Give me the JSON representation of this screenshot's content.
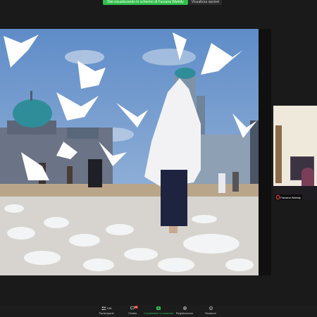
{
  "banner": {
    "sharing_text": "Stai visualizzando lo schermo di Farzana Wahidy",
    "options_label": "Visualizza opzioni"
  },
  "participant": {
    "name": "Farzana Wahidy",
    "mic_muted": true
  },
  "toolbar": {
    "participants_label": "Partecipanti",
    "participants_count": "108",
    "chat_label": "Chatta",
    "chat_badge": "26",
    "share_label": "Condividere lo schermo",
    "record_label": "Registrazione",
    "reactions_label": "Reazioni"
  },
  "colors": {
    "share_green": "#2fbf4a",
    "sky": "#5d87c2",
    "toolbar_bg": "#1c1c1c"
  },
  "icons": [
    "participants-icon",
    "chat-icon",
    "share-screen-icon",
    "record-icon",
    "reactions-icon",
    "mic-muted-icon"
  ]
}
